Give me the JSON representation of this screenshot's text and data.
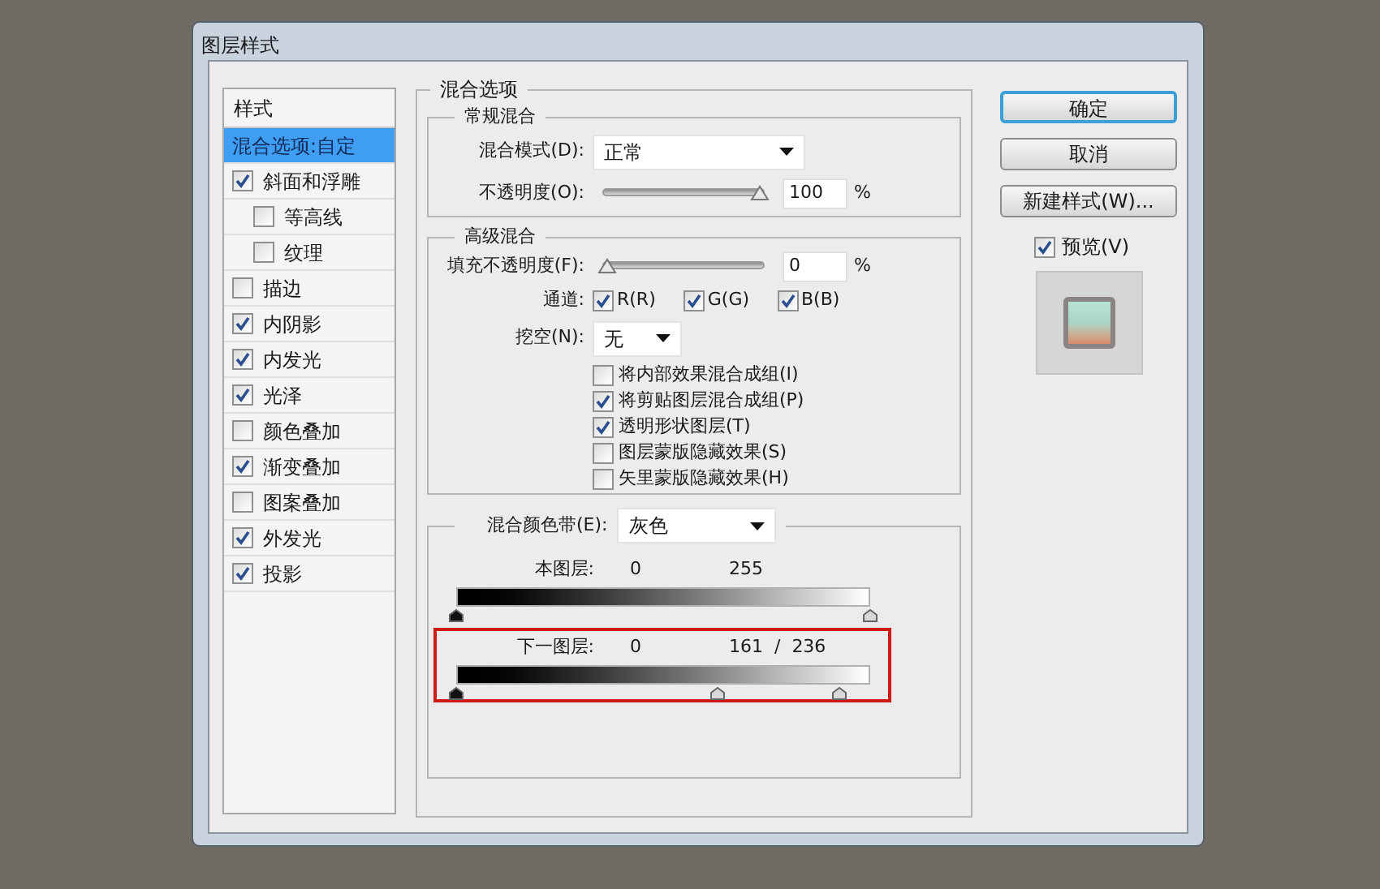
{
  "window": {
    "title": "图层样式"
  },
  "styles": {
    "header": "样式",
    "items": [
      {
        "label": "混合选项:自定",
        "kind": "option",
        "selected": true
      },
      {
        "label": "斜面和浮雕",
        "kind": "effect",
        "checked": true,
        "selected": false,
        "children": [
          {
            "label": "等高线",
            "kind": "effect",
            "checked": false,
            "selected": false
          },
          {
            "label": "纹理",
            "kind": "effect",
            "checked": false,
            "selected": false
          }
        ]
      },
      {
        "label": "描边",
        "kind": "effect",
        "checked": false,
        "selected": false
      },
      {
        "label": "内阴影",
        "kind": "effect",
        "checked": true,
        "selected": false
      },
      {
        "label": "内发光",
        "kind": "effect",
        "checked": true,
        "selected": false
      },
      {
        "label": "光泽",
        "kind": "effect",
        "checked": true,
        "selected": false
      },
      {
        "label": "颜色叠加",
        "kind": "effect",
        "checked": false,
        "selected": false
      },
      {
        "label": "渐变叠加",
        "kind": "effect",
        "checked": true,
        "selected": false
      },
      {
        "label": "图案叠加",
        "kind": "effect",
        "checked": false,
        "selected": false
      },
      {
        "label": "外发光",
        "kind": "effect",
        "checked": true,
        "selected": false
      },
      {
        "label": "投影",
        "kind": "effect",
        "checked": true,
        "selected": false
      }
    ]
  },
  "blending_options": {
    "title": "混合选项",
    "general": {
      "title": "常规混合",
      "blend_mode": {
        "label": "混合模式(D):",
        "value": "正常"
      },
      "opacity": {
        "label": "不透明度(O):",
        "level": 1,
        "value": "100",
        "unit": "%"
      }
    },
    "advanced": {
      "title": "高级混合",
      "fill_opacity": {
        "label": "填充不透明度(F):",
        "level": 0,
        "value": "0",
        "unit": "%"
      },
      "channels": {
        "label": "通道:",
        "items": [
          {
            "label": "R(R)",
            "checked": true
          },
          {
            "label": "G(G)",
            "checked": true
          },
          {
            "label": "B(B)",
            "checked": true
          }
        ]
      },
      "knockout": {
        "label": "挖空(N):",
        "value": "无"
      },
      "options": [
        {
          "label": "将内部效果混合成组(I)",
          "checked": false
        },
        {
          "label": "将剪贴图层混合成组(P)",
          "checked": true
        },
        {
          "label": "透明形状图层(T)",
          "checked": true
        },
        {
          "label": "图层蒙版隐藏效果(S)",
          "checked": false
        },
        {
          "label": "矢里蒙版隐藏效果(H)",
          "checked": false
        }
      ]
    },
    "blend_if": {
      "label": "混合颜色带(E):",
      "value": "灰色",
      "bands": [
        {
          "label": "本图层:",
          "readings": [
            "0",
            "255"
          ],
          "highlighted": false,
          "thumbs": [
            {
              "level": 0
            },
            {
              "level": 1
            }
          ]
        },
        {
          "label": "下一图层:",
          "readings": [
            "0",
            "161  /  236"
          ],
          "highlighted": true,
          "thumbs": [
            {
              "level": 0
            },
            {
              "level": 0.631
            },
            {
              "level": 0.925
            }
          ]
        }
      ]
    }
  },
  "buttons": [
    {
      "label": "确定",
      "default": true
    },
    {
      "label": "取消",
      "default": false
    },
    {
      "label": "新建样式(W)...",
      "default": false
    }
  ],
  "preview": {
    "label": "预览(V)",
    "checked": true
  }
}
